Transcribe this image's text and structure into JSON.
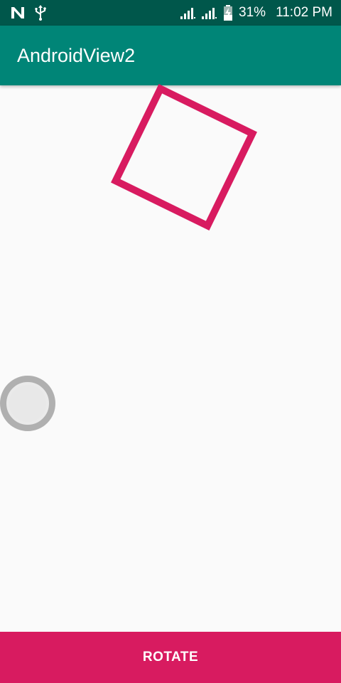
{
  "status_bar": {
    "left_icons": [
      "n-logo-icon",
      "usb-icon"
    ],
    "right_icons": [
      "signal-icon",
      "signal-icon-2",
      "battery-charging-icon"
    ],
    "battery_percent": "31%",
    "time": "11:02 PM"
  },
  "app_bar": {
    "title": "AndroidView2",
    "color": "#008577"
  },
  "canvas": {
    "shape": "rotated-square",
    "stroke_color": "#d81b60",
    "rotation_degrees": 26
  },
  "button": {
    "label": "ROTATE",
    "color": "#d81b60"
  },
  "colors": {
    "status_bar": "#00574b",
    "background": "#fafafa",
    "touch_indicator": "#b0b0b0"
  }
}
